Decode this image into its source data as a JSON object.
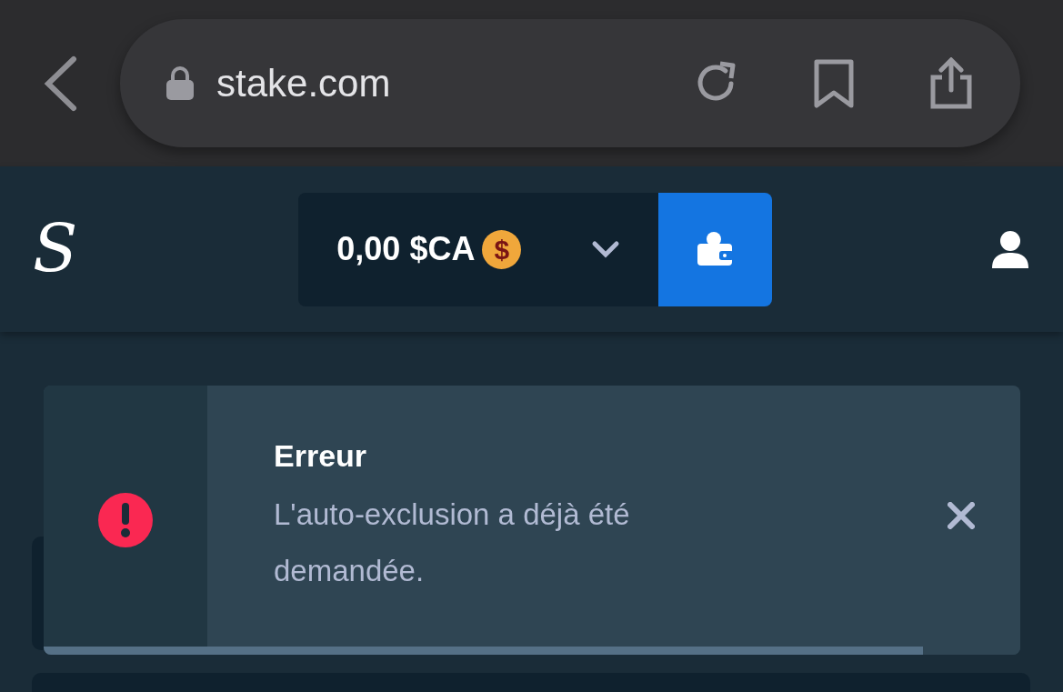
{
  "browser": {
    "url": "stake.com"
  },
  "header": {
    "logo": "S",
    "balance": "0,00 $CA",
    "currency_symbol": "$"
  },
  "toast": {
    "title": "Erreur",
    "message": "L'auto-exclusion a déjà été demandée.",
    "level": 0.9
  }
}
